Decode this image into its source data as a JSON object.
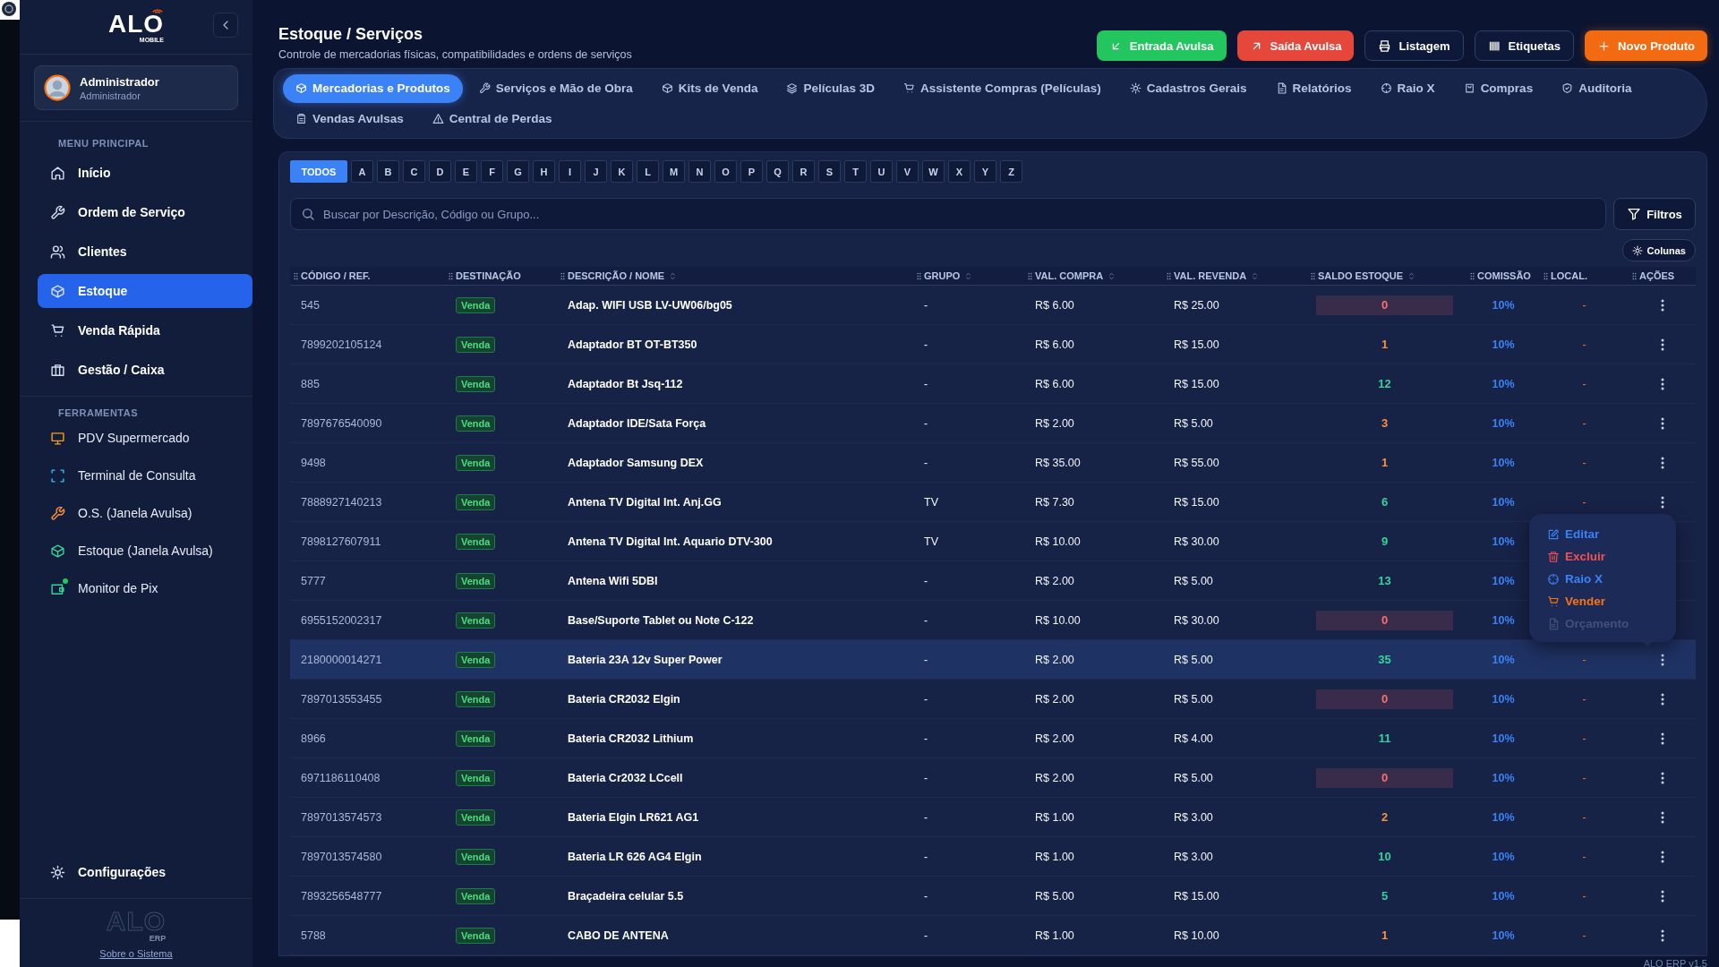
{
  "brand": {
    "name": "ALO",
    "tagline": "MOBILE"
  },
  "user": {
    "name": "Administrador",
    "role": "Administrador"
  },
  "sidebar": {
    "sections": [
      {
        "title": "MENU PRINCIPAL",
        "items": [
          {
            "label": "Início",
            "selected": false
          },
          {
            "label": "Ordem de Serviço",
            "selected": false
          },
          {
            "label": "Clientes",
            "selected": false
          },
          {
            "label": "Estoque",
            "selected": true
          },
          {
            "label": "Venda Rápida",
            "selected": false
          },
          {
            "label": "Gestão / Caixa",
            "selected": false
          }
        ]
      },
      {
        "title": "FERRAMENTAS",
        "items": [
          {
            "label": "PDV Supermercado",
            "selected": false,
            "notification": false
          },
          {
            "label": "Terminal de Consulta",
            "selected": false,
            "notification": false
          },
          {
            "label": "O.S. (Janela Avulsa)",
            "selected": false,
            "notification": false
          },
          {
            "label": "Estoque (Janela Avulsa)",
            "selected": false,
            "notification": false
          },
          {
            "label": "Monitor de Pix",
            "selected": false,
            "notification": true
          }
        ]
      }
    ],
    "settings": "Configurações",
    "footer_logo": {
      "name": "ALO",
      "tagline": "ERP"
    },
    "about_link": "Sobre o Sistema"
  },
  "page": {
    "title": "Estoque / Serviços",
    "subtitle": "Controle de mercadorias físicas, compatibilidades e ordens de serviços"
  },
  "actions": [
    {
      "label": "Entrada Avulsa",
      "kind": "entry"
    },
    {
      "label": "Saída Avulsa",
      "kind": "exit"
    },
    {
      "label": "Listagem",
      "kind": "print"
    },
    {
      "label": "Etiquetas",
      "kind": "labels"
    },
    {
      "label": "Novo Produto",
      "kind": "new"
    }
  ],
  "tabs": [
    {
      "label": "Mercadorias e Produtos",
      "selected": true
    },
    {
      "label": "Serviços e Mão de Obra",
      "selected": false
    },
    {
      "label": "Kits de Venda",
      "selected": false
    },
    {
      "label": "Películas 3D",
      "selected": false
    },
    {
      "label": "Assistente Compras (Películas)",
      "selected": false
    },
    {
      "label": "Cadastros Gerais",
      "selected": false
    },
    {
      "label": "Relatórios",
      "selected": false
    },
    {
      "label": "Raio X",
      "selected": false
    },
    {
      "label": "Compras",
      "selected": false
    },
    {
      "label": "Auditoria",
      "selected": false
    },
    {
      "label": "Vendas Avulsas",
      "selected": false
    },
    {
      "label": "Central de Perdas",
      "selected": false
    }
  ],
  "letter_filter": [
    {
      "label": "TODOS",
      "selected": true
    },
    {
      "label": "A",
      "selected": false
    },
    {
      "label": "B",
      "selected": false
    },
    {
      "label": "C",
      "selected": false
    },
    {
      "label": "D",
      "selected": false
    },
    {
      "label": "E",
      "selected": false
    },
    {
      "label": "F",
      "selected": false
    },
    {
      "label": "G",
      "selected": false
    },
    {
      "label": "H",
      "selected": false
    },
    {
      "label": "I",
      "selected": false
    },
    {
      "label": "J",
      "selected": false
    },
    {
      "label": "K",
      "selected": false
    },
    {
      "label": "L",
      "selected": false
    },
    {
      "label": "M",
      "selected": false
    },
    {
      "label": "N",
      "selected": false
    },
    {
      "label": "O",
      "selected": false
    },
    {
      "label": "P",
      "selected": false
    },
    {
      "label": "Q",
      "selected": false
    },
    {
      "label": "R",
      "selected": false
    },
    {
      "label": "S",
      "selected": false
    },
    {
      "label": "T",
      "selected": false
    },
    {
      "label": "U",
      "selected": false
    },
    {
      "label": "V",
      "selected": false
    },
    {
      "label": "W",
      "selected": false
    },
    {
      "label": "X",
      "selected": false
    },
    {
      "label": "Y",
      "selected": false
    },
    {
      "label": "Z",
      "selected": false
    }
  ],
  "search": {
    "placeholder": "Buscar por Descrição, Código ou Grupo..."
  },
  "filters_button": "Filtros",
  "columns_button": "Colunas",
  "table": {
    "columns": [
      {
        "label": "CÓDIGO / REF.",
        "sortable": false
      },
      {
        "label": "DESTINAÇÃO",
        "sortable": false
      },
      {
        "label": "DESCRIÇÃO / NOME",
        "sortable": true
      },
      {
        "label": "GRUPO",
        "sortable": true
      },
      {
        "label": "VAL. COMPRA",
        "sortable": true
      },
      {
        "label": "VAL. REVENDA",
        "sortable": true
      },
      {
        "label": "SALDO ESTOQUE",
        "sortable": true
      },
      {
        "label": "COMISSÃO",
        "sortable": false
      },
      {
        "label": "LOCAL.",
        "sortable": false
      },
      {
        "label": "AÇÕES",
        "sortable": false
      }
    ],
    "rows": [
      {
        "code": "545",
        "destination": "Venda",
        "description": "Adap. WIFI USB LV-UW06/bg05",
        "group": "-",
        "purchase": "R$ 6.00",
        "resale": "R$ 25.00",
        "stock": "0",
        "kind": "out",
        "commission": "10%",
        "location": "-",
        "selected": false
      },
      {
        "code": "7899202105124",
        "destination": "Venda",
        "description": "Adaptador BT OT-BT350",
        "group": "-",
        "purchase": "R$ 6.00",
        "resale": "R$ 15.00",
        "stock": "1",
        "kind": "low",
        "commission": "10%",
        "location": "-",
        "selected": false
      },
      {
        "code": "885",
        "destination": "Venda",
        "description": "Adaptador Bt Jsq-112",
        "group": "-",
        "purchase": "R$ 6.00",
        "resale": "R$ 15.00",
        "stock": "12",
        "kind": "ok",
        "commission": "10%",
        "location": "-",
        "selected": false
      },
      {
        "code": "7897676540090",
        "destination": "Venda",
        "description": "Adaptador IDE/Sata Força",
        "group": "-",
        "purchase": "R$ 2.00",
        "resale": "R$ 5.00",
        "stock": "3",
        "kind": "low",
        "commission": "10%",
        "location": "-",
        "selected": false
      },
      {
        "code": "9498",
        "destination": "Venda",
        "description": "Adaptador Samsung DEX",
        "group": "-",
        "purchase": "R$ 35.00",
        "resale": "R$ 55.00",
        "stock": "1",
        "kind": "low",
        "commission": "10%",
        "location": "-",
        "selected": false
      },
      {
        "code": "7888927140213",
        "destination": "Venda",
        "description": "Antena TV Digital Int. Anj.GG",
        "group": "TV",
        "purchase": "R$ 7.30",
        "resale": "R$ 15.00",
        "stock": "6",
        "kind": "ok",
        "commission": "10%",
        "location": "-",
        "selected": false
      },
      {
        "code": "7898127607911",
        "destination": "Venda",
        "description": "Antena TV Digital Int. Aquario DTV-300",
        "group": "TV",
        "purchase": "R$ 10.00",
        "resale": "R$ 30.00",
        "stock": "9",
        "kind": "ok",
        "commission": "10%",
        "selected": false
      },
      {
        "code": "5777",
        "destination": "Venda",
        "description": "Antena Wifi 5DBI",
        "group": "-",
        "purchase": "R$ 2.00",
        "resale": "R$ 5.00",
        "stock": "13",
        "kind": "ok",
        "commission": "10%",
        "selected": false
      },
      {
        "code": "6955152002317",
        "destination": "Venda",
        "description": "Base/Suporte Tablet ou Note C-122",
        "group": "-",
        "purchase": "R$ 10.00",
        "resale": "R$ 30.00",
        "stock": "0",
        "kind": "out",
        "commission": "10%",
        "selected": false
      },
      {
        "code": "2180000014271",
        "destination": "Venda",
        "description": "Bateria 23A 12v Super Power",
        "group": "-",
        "purchase": "R$ 2.00",
        "resale": "R$ 5.00",
        "stock": "35",
        "kind": "ok",
        "commission": "10%",
        "location": "-",
        "selected": true
      },
      {
        "code": "7897013553455",
        "destination": "Venda",
        "description": "Bateria CR2032 Elgin",
        "group": "-",
        "purchase": "R$ 2.00",
        "resale": "R$ 5.00",
        "stock": "0",
        "kind": "out",
        "commission": "10%",
        "location": "-",
        "selected": false
      },
      {
        "code": "8966",
        "destination": "Venda",
        "description": "Bateria CR2032 Lithium",
        "group": "-",
        "purchase": "R$ 2.00",
        "resale": "R$ 4.00",
        "stock": "11",
        "kind": "ok",
        "commission": "10%",
        "location": "-",
        "selected": false
      },
      {
        "code": "6971186110408",
        "destination": "Venda",
        "description": "Bateria Cr2032 LCcell",
        "group": "-",
        "purchase": "R$ 2.00",
        "resale": "R$ 5.00",
        "stock": "0",
        "kind": "out",
        "commission": "10%",
        "location": "-",
        "selected": false
      },
      {
        "code": "7897013574573",
        "destination": "Venda",
        "description": "Bateria Elgin LR621 AG1",
        "group": "-",
        "purchase": "R$ 1.00",
        "resale": "R$ 3.00",
        "stock": "2",
        "kind": "low",
        "commission": "10%",
        "location": "-",
        "selected": false
      },
      {
        "code": "7897013574580",
        "destination": "Venda",
        "description": "Bateria LR 626 AG4 Elgin",
        "group": "-",
        "purchase": "R$ 1.00",
        "resale": "R$ 3.00",
        "stock": "10",
        "kind": "ok",
        "commission": "10%",
        "location": "-",
        "selected": false
      },
      {
        "code": "7893256548777",
        "destination": "Venda",
        "description": "Braçadeira celular 5.5",
        "group": "-",
        "purchase": "R$ 5.00",
        "resale": "R$ 15.00",
        "stock": "5",
        "kind": "ok",
        "commission": "10%",
        "location": "-",
        "selected": false
      },
      {
        "code": "5788",
        "destination": "Venda",
        "description": "CABO DE ANTENA",
        "group": "-",
        "purchase": "R$ 1.00",
        "resale": "R$ 10.00",
        "stock": "1",
        "kind": "low",
        "commission": "10%",
        "location": "-",
        "selected": false
      }
    ]
  },
  "context_menu": {
    "items": [
      {
        "label": "Editar",
        "kind": "edit",
        "disabled": false
      },
      {
        "label": "Excluir",
        "kind": "delete",
        "disabled": false
      },
      {
        "label": "Raio X",
        "kind": "xray",
        "disabled": false
      },
      {
        "label": "Vender",
        "kind": "sell",
        "disabled": false
      },
      {
        "label": "Orçamento",
        "kind": "quote",
        "disabled": true
      }
    ]
  },
  "version": "ALO ERP v1.5"
}
